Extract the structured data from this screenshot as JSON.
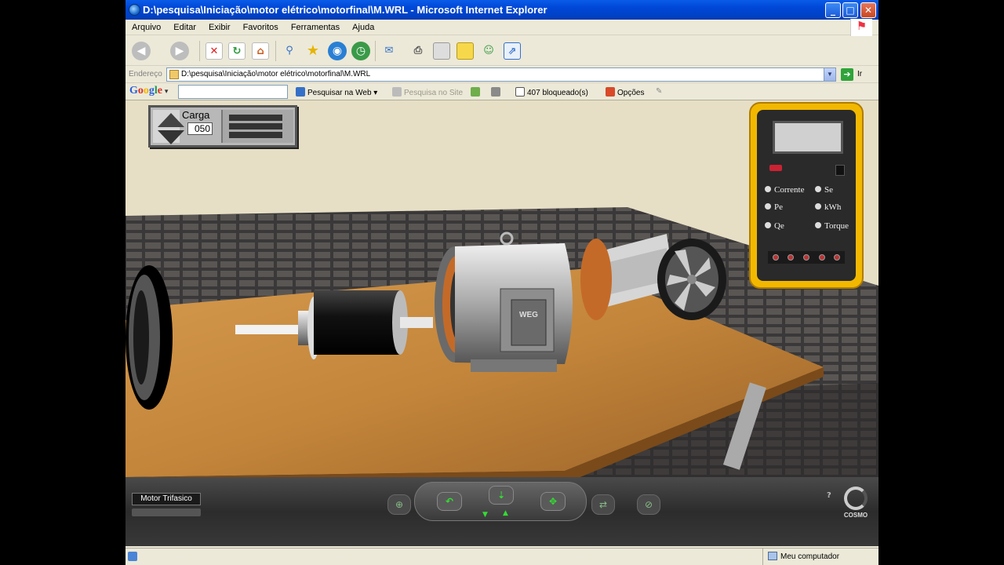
{
  "window": {
    "title": "D:\\pesquisa\\Iniciação\\motor elétrico\\motorfinal\\M.WRL - Microsoft Internet Explorer",
    "minimize_glyph": "_",
    "maximize_glyph": "□",
    "close_glyph": "✕"
  },
  "menu": [
    "Arquivo",
    "Editar",
    "Exibir",
    "Favoritos",
    "Ferramentas",
    "Ajuda"
  ],
  "address": {
    "label": "Endereço",
    "value": "D:\\pesquisa\\Iniciação\\motor elétrico\\motorfinal\\M.WRL",
    "go_label": "Ir"
  },
  "google_toolbar": {
    "logo": "Google",
    "search_web": "Pesquisar na Web",
    "search_site": "Pesquisa no Site",
    "blocked": "407 bloqueado(s)",
    "options": "Opções"
  },
  "scene": {
    "load_panel": {
      "label": "Carga",
      "value": "050"
    },
    "multimeter": {
      "options": [
        "Corrente",
        "Se",
        "Pe",
        "kWh",
        "Qe",
        "Torque"
      ]
    },
    "motor_brand": "WEG"
  },
  "navigator": {
    "viewpoint": "Motor Trifasico",
    "brand": "COSMO"
  },
  "status": {
    "zone": "Meu computador"
  },
  "colors": {
    "titlebar": "#0047d6",
    "chrome": "#ece9d8",
    "meter_yellow": "#f2b800",
    "table_wood": "#c98a3f",
    "nav_green": "#33dd33"
  },
  "icons": {
    "back": "back-arrow-icon",
    "forward": "forward-arrow-icon",
    "stop": "stop-icon",
    "refresh": "refresh-icon",
    "home": "home-icon",
    "search": "search-icon",
    "favorites": "star-icon",
    "media": "globe-icon",
    "history": "history-icon"
  }
}
